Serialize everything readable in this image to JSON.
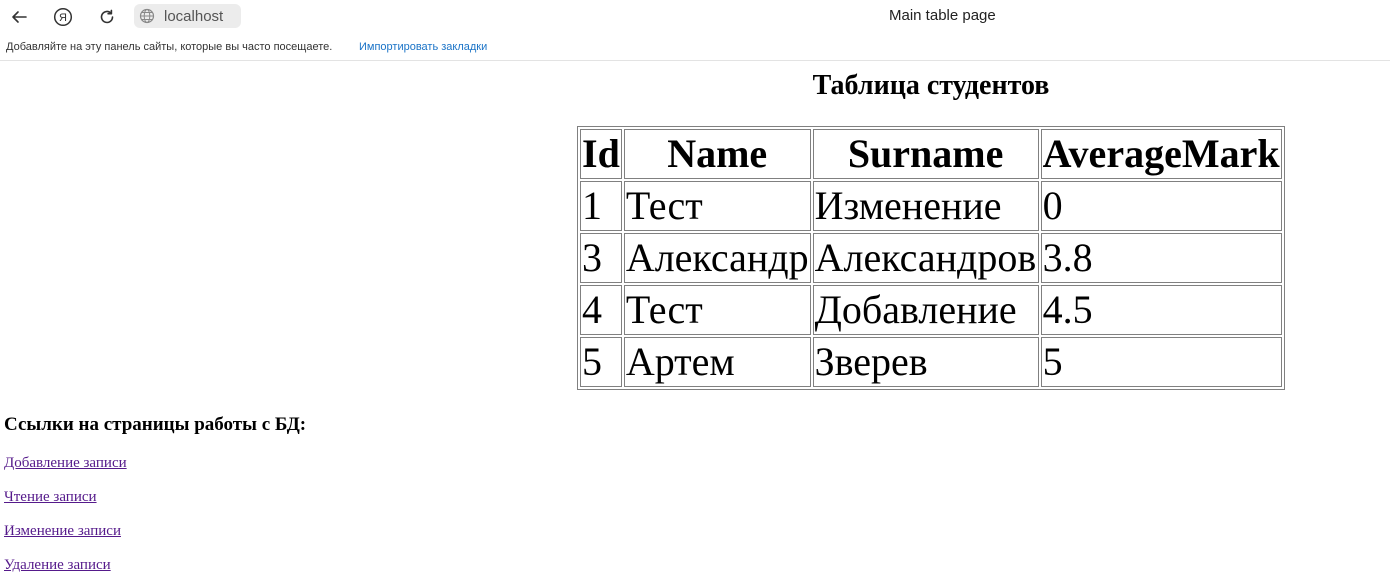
{
  "browser": {
    "url": "localhost",
    "page_title": "Main table page",
    "icons": [
      "back-arrow-icon",
      "yandex-icon",
      "reload-icon",
      "globe-icon"
    ]
  },
  "bookmarks_bar": {
    "hint": "Добавляйте на эту панель сайты, которые вы часто посещаете.",
    "import_link": "Импортировать закладки"
  },
  "page": {
    "heading": "Таблица студентов",
    "table": {
      "headers": [
        "Id",
        "Name",
        "Surname",
        "AverageMark"
      ],
      "rows": [
        [
          "1",
          "Тест",
          "Изменение",
          "0"
        ],
        [
          "3",
          "Александр",
          "Александров",
          "3.8"
        ],
        [
          "4",
          "Тест",
          "Добавление",
          "4.5"
        ],
        [
          "5",
          "Артем",
          "Зверев",
          "5"
        ]
      ]
    },
    "links_title": "Ссылки на страницы работы с БД:",
    "links": [
      "Добавление записи",
      "Чтение записи",
      "Изменение записи",
      "Удаление записи"
    ]
  },
  "colors": {
    "visited_link": "#551a8b",
    "bookmark_link": "#1a73c7",
    "table_border": "#808080"
  }
}
